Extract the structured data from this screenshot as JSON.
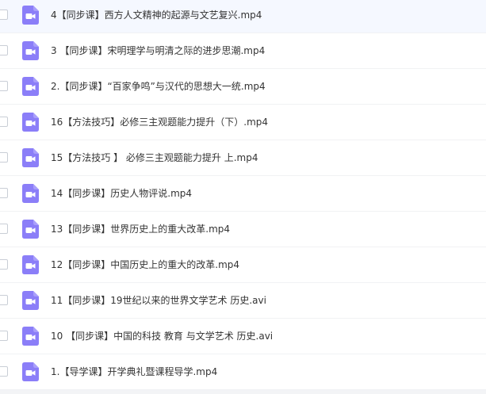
{
  "theme": {
    "icon_color": "#8b7ef8",
    "text_color": "#333333",
    "divider_color": "#f1f2f4"
  },
  "file_list": {
    "icon_type": "video-file-icon",
    "items": [
      {
        "name": "4【同步课】西方人文精神的起源与文艺复兴.mp4"
      },
      {
        "name": "3 【同步课】宋明理学与明清之际的进步思潮.mp4"
      },
      {
        "name": "2.【同步课】“百家争鸣”与汉代的思想大一统.mp4"
      },
      {
        "name": "16【方法技巧】必修三主观题能力提升（下）.mp4"
      },
      {
        "name": "15【方法技巧 】 必修三主观题能力提升 上.mp4"
      },
      {
        "name": "14【同步课】历史人物评说.mp4"
      },
      {
        "name": "13【同步课】世界历史上的重大改革.mp4"
      },
      {
        "name": "12【同步课】中国历史上的重大的改革.mp4"
      },
      {
        "name": "11【同步课】19世纪以来的世界文学艺术 历史.avi"
      },
      {
        "name": "10 【同步课】中国的科技 教育 与文学艺术 历史.avi"
      },
      {
        "name": "1.【导学课】开学典礼暨课程导学.mp4"
      }
    ]
  }
}
